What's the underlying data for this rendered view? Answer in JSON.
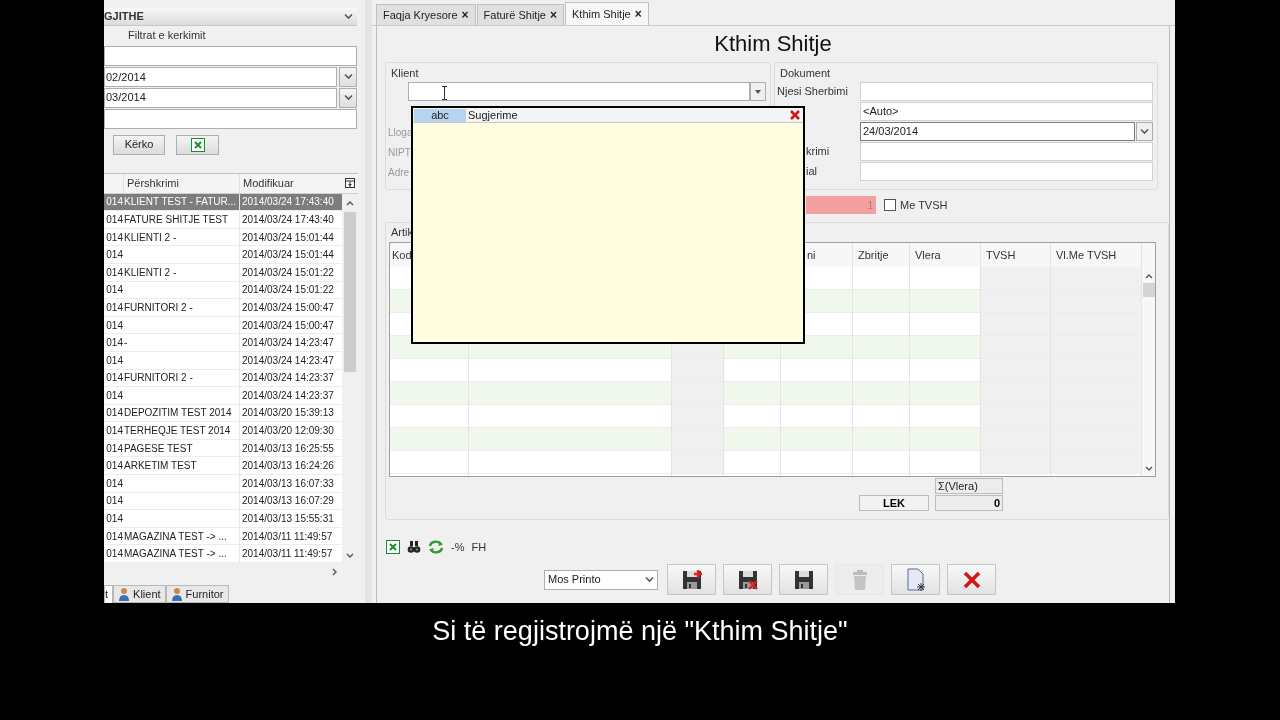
{
  "left_panel": {
    "header": "GJITHE",
    "filter_title": "Filtrat e kerkimit",
    "filters": [
      {
        "kind": "text"
      },
      {
        "kind": "date",
        "value": "02/2014"
      },
      {
        "kind": "date",
        "value": "03/2014"
      },
      {
        "kind": "text"
      }
    ],
    "search_button": "Kërko",
    "table": {
      "columns": [
        {
          "label": "Përshkrimi"
        },
        {
          "label": "Modifikuar"
        }
      ],
      "rows": [
        {
          "column_1": "014",
          "description": "KLIENT TEST - FATUR...",
          "modified": "2014/03/24 17:43:40",
          "selected": true
        },
        {
          "column_1": "014",
          "description": "FATURE SHITJE TEST",
          "modified": "2014/03/24 17:43:40",
          "selected": false
        },
        {
          "column_1": "014",
          "description": "KLIENTI 2 -",
          "modified": "2014/03/24 15:01:44",
          "selected": false
        },
        {
          "column_1": "014",
          "modified": "2014/03/24 15:01:44",
          "selected": false
        },
        {
          "column_1": "014",
          "description": "KLIENTI 2 -",
          "modified": "2014/03/24 15:01:22",
          "selected": false
        },
        {
          "column_1": "014",
          "modified": "2014/03/24 15:01:22",
          "selected": false
        },
        {
          "column_1": "014",
          "description": "FURNITORI 2 -",
          "modified": "2014/03/24 15:00:47",
          "selected": false
        },
        {
          "column_1": "014",
          "modified": "2014/03/24 15:00:47",
          "selected": false
        },
        {
          "column_1": "014",
          "description": "-",
          "modified": "2014/03/24 14:23:47",
          "selected": false
        },
        {
          "column_1": "014",
          "modified": "2014/03/24 14:23:47",
          "selected": false
        },
        {
          "column_1": "014",
          "description": "FURNITORI 2 -",
          "modified": "2014/03/24 14:23:37",
          "selected": false
        },
        {
          "column_1": "014",
          "modified": "2014/03/24 14:23:37",
          "selected": false
        },
        {
          "column_1": "014",
          "description": "DEPOZITIM TEST 2014",
          "modified": "2014/03/20 15:39:13",
          "selected": false
        },
        {
          "column_1": "014",
          "description": "TERHEQJE TEST 2014",
          "modified": "2014/03/20 12:09:30",
          "selected": false
        },
        {
          "column_1": "014",
          "description": "PAGESE TEST",
          "modified": "2014/03/13 16:25:55",
          "selected": false
        },
        {
          "column_1": "014",
          "description": "ARKETIM TEST",
          "modified": "2014/03/13 16:24:26",
          "selected": false
        },
        {
          "column_1": "014",
          "modified": "2014/03/13 16:07:33",
          "selected": false
        },
        {
          "column_1": "014",
          "modified": "2014/03/13 16:07:29",
          "selected": false
        },
        {
          "column_1": "014",
          "modified": "2014/03/13 15:55:31",
          "selected": false
        },
        {
          "column_1": "014",
          "description": "MAGAZINA TEST -> ...",
          "modified": "2014/03/11 11:49:57",
          "selected": false
        },
        {
          "column_1": "014",
          "description": "MAGAZINA TEST -> ...",
          "modified": "2014/03/11 11:49:57",
          "selected": false
        }
      ]
    },
    "bottom_tabs": [
      {
        "label": "t",
        "icon": false,
        "selected": true
      },
      {
        "label": "Klient",
        "icon": true,
        "selected": false
      },
      {
        "label": "Furnitor",
        "icon": true,
        "selected": false
      }
    ]
  },
  "main": {
    "tabs": [
      {
        "label": "Faqja Kryesore",
        "close": "×",
        "selected": false
      },
      {
        "label": "Faturë Shitje",
        "close": "×",
        "selected": false
      },
      {
        "label": "Kthim Shitje",
        "close": "×",
        "selected": true
      }
    ],
    "title": "Kthim Shitje",
    "klient": {
      "legend": "Klient",
      "labels": [
        "Lloga",
        "NIPT",
        "Adre"
      ]
    },
    "suggestions": {
      "badge": "abc",
      "title": "Sugjerime"
    },
    "dokument": {
      "legend": "Dokument",
      "fields": [
        {
          "label": "Njesi Sherbimi",
          "kind": "text"
        },
        {
          "kind": "text",
          "value": "<Auto>"
        },
        {
          "kind": "date",
          "value": "24/03/2014"
        },
        {
          "label": "krimi",
          "kind": "text"
        },
        {
          "label": "ial",
          "kind": "text"
        }
      ]
    },
    "number_field": "1",
    "vat_checkbox": {
      "label": "Me TVSH",
      "checked": false
    },
    "items": {
      "legend": "Artik",
      "columns": [
        {
          "label": "Kod",
          "readonly": false
        },
        {
          "readonly": false
        },
        {
          "readonly": true
        },
        {
          "readonly": false
        },
        {
          "label": "ni",
          "readonly": false
        },
        {
          "label": "Zbritje",
          "readonly": false
        },
        {
          "label": "Vlera",
          "readonly": false
        },
        {
          "label": "TVSH",
          "readonly": true
        },
        {
          "label": "Vl.Me TVSH",
          "readonly": true
        }
      ],
      "sum_label": "Σ(Vlera)",
      "currency": "LEK",
      "sum_value": "0"
    },
    "toolbar": [
      {
        "kind": "excel"
      },
      {
        "kind": "binoculars"
      },
      {
        "kind": "refresh"
      },
      {
        "kind": "text",
        "label": "-%"
      },
      {
        "kind": "text",
        "label": "FH"
      }
    ],
    "print_select": "Mos Printo",
    "actions": [
      {
        "kind": "save-new",
        "disabled": false
      },
      {
        "kind": "save-delete",
        "disabled": false
      },
      {
        "kind": "save",
        "disabled": false
      },
      {
        "kind": "delete",
        "disabled": true
      },
      {
        "kind": "new",
        "disabled": false
      },
      {
        "kind": "close",
        "disabled": false
      }
    ]
  },
  "subtitle": "Si të regjistrojmë një \"Kthim Shitje\""
}
